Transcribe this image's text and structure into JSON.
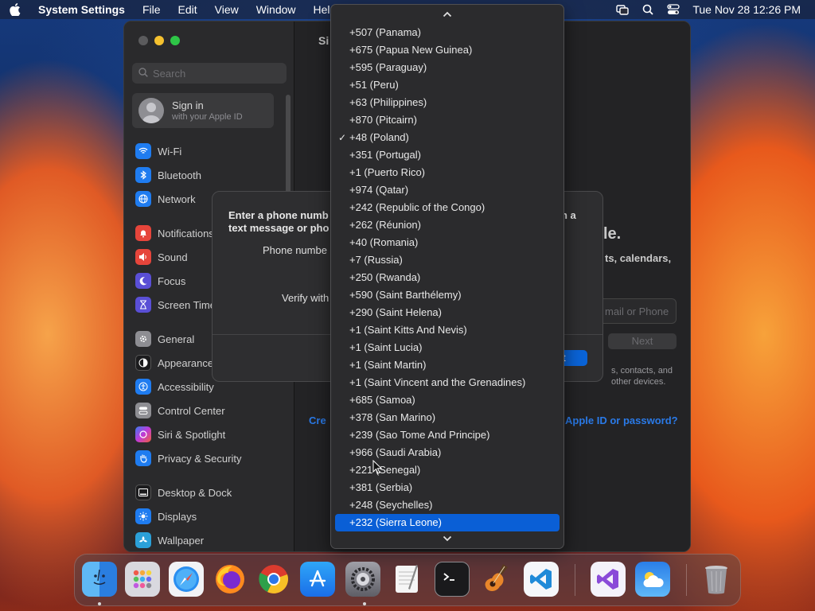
{
  "menubar": {
    "app_name": "System Settings",
    "items": [
      "File",
      "Edit",
      "View",
      "Window",
      "Help"
    ],
    "clock": "Tue Nov 28  12:26 PM"
  },
  "sidebar": {
    "search_placeholder": "Search",
    "signin_title": "Sign in",
    "signin_subtitle": "with your Apple ID",
    "items": [
      {
        "label": "Wi-Fi",
        "icon": "wifi-icon",
        "color": "#1f7cf0"
      },
      {
        "label": "Bluetooth",
        "icon": "bluetooth-icon",
        "color": "#1f7cf0"
      },
      {
        "label": "Network",
        "icon": "globe-icon",
        "color": "#1f7cf0"
      },
      {
        "label": "Notifications",
        "icon": "bell-icon",
        "color": "#e6453b"
      },
      {
        "label": "Sound",
        "icon": "speaker-icon",
        "color": "#e6453b"
      },
      {
        "label": "Focus",
        "icon": "moon-icon",
        "color": "#5a4fd6"
      },
      {
        "label": "Screen Time",
        "icon": "hourglass-icon",
        "color": "#5a4fd6"
      },
      {
        "label": "General",
        "icon": "gear-icon",
        "color": "#8e8e93"
      },
      {
        "label": "Appearance",
        "icon": "appearance-icon",
        "color": "#1c1c1e"
      },
      {
        "label": "Accessibility",
        "icon": "accessibility-icon",
        "color": "#1f7cf0"
      },
      {
        "label": "Control Center",
        "icon": "control-center-icon",
        "color": "#8e8e93"
      },
      {
        "label": "Siri & Spotlight",
        "icon": "siri-icon",
        "color": "#9b3fd0"
      },
      {
        "label": "Privacy & Security",
        "icon": "hand-icon",
        "color": "#1f7cf0"
      },
      {
        "label": "Desktop & Dock",
        "icon": "dock-icon",
        "color": "#1c1c1e"
      },
      {
        "label": "Displays",
        "icon": "sun-icon",
        "color": "#1f7cf0"
      },
      {
        "label": "Wallpaper",
        "icon": "wallpaper-icon",
        "color": "#2ba0d8"
      }
    ]
  },
  "main": {
    "title": "Si",
    "partial_heading": "le.",
    "partial_line": "ts, calendars,",
    "email_placeholder": "mail or Phone",
    "next_label": "Next",
    "partial_contacts": "s, contacts, and",
    "partial_devices": "other devices.",
    "create_link": "Cre",
    "forgot_link": "Apple ID or password?"
  },
  "dialog": {
    "title_line1": "Enter a phone numb",
    "title_line2": "text message or pho",
    "title_right": "n a",
    "phone_label": "Phone numbe",
    "verify_label": "Verify with",
    "ok_label": "t"
  },
  "popup": {
    "options": [
      "+507 (Panama)",
      "+675 (Papua New Guinea)",
      "+595 (Paraguay)",
      "+51 (Peru)",
      "+63 (Philippines)",
      "+870 (Pitcairn)",
      "+48 (Poland)",
      "+351 (Portugal)",
      "+1 (Puerto Rico)",
      "+974 (Qatar)",
      "+242 (Republic of the Congo)",
      "+262 (Réunion)",
      "+40 (Romania)",
      "+7 (Russia)",
      "+250 (Rwanda)",
      "+590 (Saint Barthélemy)",
      "+290 (Saint Helena)",
      "+1 (Saint Kitts And Nevis)",
      "+1 (Saint Lucia)",
      "+1 (Saint Martin)",
      "+1 (Saint Vincent and the Grenadines)",
      "+685 (Samoa)",
      "+378 (San Marino)",
      "+239 (Sao Tome And Principe)",
      "+966 (Saudi Arabia)",
      "+221 (Senegal)",
      "+381 (Serbia)",
      "+248 (Seychelles)",
      "+232 (Sierra Leone)"
    ],
    "checked_index": 6,
    "highlighted_index": 28,
    "check_glyph": "✓"
  },
  "dock": {
    "apps": [
      "finder-icon",
      "launchpad-icon",
      "safari-icon",
      "firefox-icon",
      "chrome-icon",
      "app-store-icon",
      "system-settings-icon",
      "textedit-icon",
      "terminal-icon",
      "garageband-icon",
      "vscode-icon",
      "visual-studio-icon",
      "weather-icon",
      "trash-icon"
    ]
  }
}
